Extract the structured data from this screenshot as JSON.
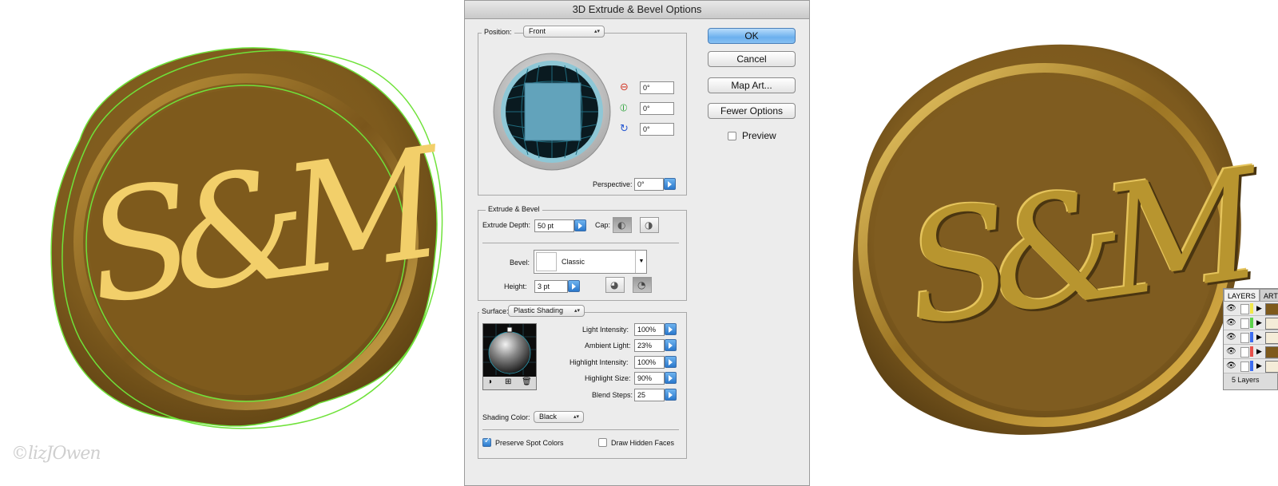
{
  "watermark": "©lizJOwen",
  "left_seal": {
    "monogram": "S&M"
  },
  "dialog": {
    "title": "3D Extrude & Bevel Options",
    "position": {
      "label": "Position:",
      "value": "Front",
      "rot_x": "0°",
      "rot_y": "0°",
      "rot_z": "0°",
      "perspective_label": "Perspective:",
      "perspective_value": "0°"
    },
    "extrude": {
      "group_label": "Extrude & Bevel",
      "depth_label": "Extrude Depth:",
      "depth_value": "50 pt",
      "cap_label": "Cap:",
      "bevel_label": "Bevel:",
      "bevel_value": "Classic",
      "height_label": "Height:",
      "height_value": "3 pt"
    },
    "surface": {
      "label": "Surface:",
      "value": "Plastic Shading",
      "light_intensity_label": "Light Intensity:",
      "light_intensity": "100%",
      "ambient_label": "Ambient Light:",
      "ambient": "23%",
      "highlight_intensity_label": "Highlight Intensity:",
      "highlight_intensity": "100%",
      "highlight_size_label": "Highlight Size:",
      "highlight_size": "90%",
      "blend_steps_label": "Blend Steps:",
      "blend_steps": "25",
      "shading_color_label": "Shading Color:",
      "shading_color": "Black",
      "preserve_spot_label": "Preserve Spot Colors",
      "preserve_spot_checked": true,
      "draw_hidden_label": "Draw Hidden Faces",
      "draw_hidden_checked": false
    },
    "buttons": {
      "ok": "OK",
      "cancel": "Cancel",
      "map_art": "Map Art...",
      "fewer_options": "Fewer Options",
      "preview_label": "Preview",
      "preview_checked": false
    }
  },
  "layers_panel": {
    "tab_layers": "LAYERS",
    "tab_art": "ART",
    "footer": "5 Layers",
    "layer_colors": [
      "#f2e84a",
      "#5ad24a",
      "#3c6cf0",
      "#e8504a",
      "#3c6cf0"
    ]
  },
  "colors": {
    "wax": "#7e5a1c",
    "wax_light": "#a9832f",
    "monogram": "#f2cf6a",
    "outline": "#6fe23a"
  }
}
